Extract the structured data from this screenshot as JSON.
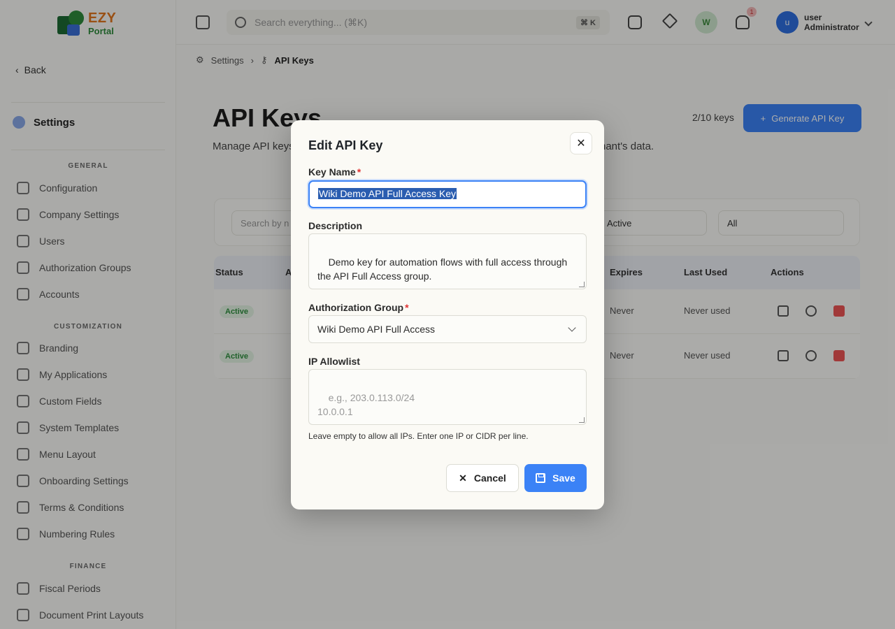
{
  "logo": {
    "line1": "EZY",
    "line2": "Portal"
  },
  "sidebar": {
    "back_label": "Back",
    "settings_label": "Settings",
    "sections": {
      "general": "GENERAL",
      "customization": "CUSTOMIZATION",
      "finance": "FINANCE"
    },
    "items": [
      {
        "label": "Configuration"
      },
      {
        "label": "Company Settings"
      },
      {
        "label": "Users"
      },
      {
        "label": "Authorization Groups"
      },
      {
        "label": "Accounts"
      },
      {
        "label": "Branding"
      },
      {
        "label": "My Applications"
      },
      {
        "label": "Custom Fields"
      },
      {
        "label": "System Templates"
      },
      {
        "label": "Menu Layout"
      },
      {
        "label": "Onboarding Settings"
      },
      {
        "label": "Terms & Conditions"
      },
      {
        "label": "Numbering Rules"
      },
      {
        "label": "Fiscal Periods"
      },
      {
        "label": "Document Print Layouts"
      }
    ]
  },
  "topbar": {
    "search_placeholder": "Search everything... (⌘K)",
    "kbd": "⌘ K",
    "avatar_initial": "W",
    "notif_count": "1",
    "user_initial": "u",
    "user_name": "user",
    "user_role": "Administrator"
  },
  "breadcrumb": {
    "root": "Settings",
    "current": "API Keys"
  },
  "page": {
    "title": "API Keys",
    "subtitle": "Manage API keys",
    "subtitle_tail": "nant's data.",
    "key_count": "2/10 keys",
    "generate_label": "Generate API Key"
  },
  "filters": {
    "search_placeholder": "Search by n",
    "status": "Active",
    "group": "All"
  },
  "table": {
    "headers": {
      "status": "Status",
      "a": "A",
      "expires": "Expires",
      "last_used": "Last Used",
      "actions": "Actions"
    },
    "rows": [
      {
        "status": "Active",
        "expires": "Never",
        "last_used": "Never used"
      },
      {
        "status": "Active",
        "expires": "Never",
        "last_used": "Never used"
      }
    ]
  },
  "modal": {
    "title": "Edit API Key",
    "key_name_label": "Key Name",
    "required_mark": "*",
    "key_name_value": "Wiki Demo API Full Access Key",
    "description_label": "Description",
    "description_value": "Demo key for automation flows with full access through\nthe API Full Access group.",
    "auth_group_label": "Authorization Group",
    "auth_group_value": "Wiki Demo API Full Access",
    "ip_label": "IP Allowlist",
    "ip_placeholder": "e.g., 203.0.113.0/24\n10.0.0.1",
    "ip_hint": "Leave empty to allow all IPs. Enter one IP or CIDR per line.",
    "cancel_label": "Cancel",
    "save_label": "Save"
  },
  "colors": {
    "accent": "#3b82f6",
    "required": "#e03131",
    "active_badge": "#2f8f3f"
  }
}
